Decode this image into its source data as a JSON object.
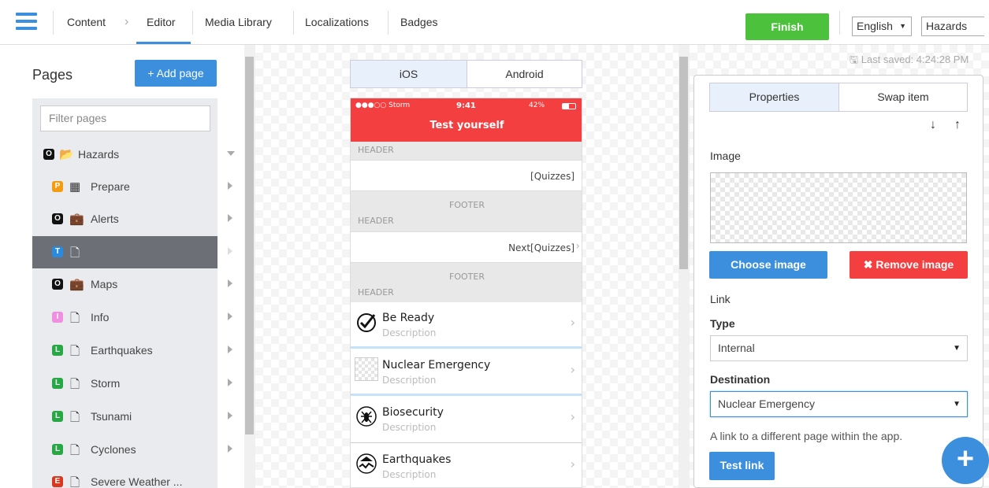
{
  "nav": {
    "items": [
      "Content",
      "Editor",
      "Media Library",
      "Localizations",
      "Badges"
    ],
    "finish_label": "Finish",
    "language": "English",
    "app_select": "Hazards"
  },
  "sidebar": {
    "title": "Pages",
    "add_label": "+ Add page",
    "filter_placeholder": "Filter pages",
    "rows": [
      {
        "badge": "O",
        "badge_color": "#111111",
        "icon": "folder-icon",
        "label": "Hazards"
      },
      {
        "badge": "P",
        "badge_color": "#f39c12",
        "icon": "grid-icon",
        "label": "Prepare"
      },
      {
        "badge": "O",
        "badge_color": "#111111",
        "icon": "briefcase-icon",
        "label": "Alerts"
      },
      {
        "badge": "T",
        "badge_color": "#2a8ae0",
        "icon": "page-icon",
        "label": ""
      },
      {
        "badge": "O",
        "badge_color": "#111111",
        "icon": "briefcase-icon",
        "label": "Maps"
      },
      {
        "badge": "I",
        "badge_color": "#f08ee0",
        "icon": "page-icon",
        "label": "Info"
      },
      {
        "badge": "L",
        "badge_color": "#27a844",
        "icon": "page-icon",
        "label": "Earthquakes"
      },
      {
        "badge": "L",
        "badge_color": "#27a844",
        "icon": "page-icon",
        "label": "Storm"
      },
      {
        "badge": "L",
        "badge_color": "#27a844",
        "icon": "page-icon",
        "label": "Tsunami"
      },
      {
        "badge": "L",
        "badge_color": "#27a844",
        "icon": "page-icon",
        "label": "Cyclones"
      },
      {
        "badge": "E",
        "badge_color": "#d9381e",
        "icon": "page-icon",
        "label": "Severe Weather ..."
      }
    ]
  },
  "preview": {
    "tabs": [
      "iOS",
      "Android"
    ],
    "status_left": "●●●○○ Storm",
    "status_time": "9:41",
    "status_right": "42%",
    "screen_title": "Test yourself",
    "header_label": "HEADER",
    "footer_label": "FOOTER",
    "quizzes_label": "[Quizzes]",
    "next_label": "Next[Quizzes]",
    "items": [
      {
        "title": "Be Ready",
        "desc": "Description",
        "icon": "check-icon"
      },
      {
        "title": "Nuclear Emergency",
        "desc": "Description",
        "icon": "image-placeholder-icon"
      },
      {
        "title": "Biosecurity",
        "desc": "Description",
        "icon": "bug-icon"
      },
      {
        "title": "Earthquakes",
        "desc": "Description",
        "icon": "earthquake-icon"
      }
    ]
  },
  "properties": {
    "last_saved": "Last saved: 4:24:28 PM",
    "tabs": [
      "Properties",
      "Swap item"
    ],
    "image_label": "Image",
    "choose_image": "Choose image",
    "remove_image": "✖ Remove image",
    "link_label": "Link",
    "type_label": "Type",
    "type_value": "Internal",
    "destination_label": "Destination",
    "destination_value": "Nuclear Emergency",
    "help_text": "A link to a different page within the app.",
    "test_link": "Test link"
  },
  "colors": {
    "accent": "#3b8fdd",
    "finish": "#4cc13b",
    "danger": "#f33f3f",
    "ios_bar": "#f33f3f"
  }
}
